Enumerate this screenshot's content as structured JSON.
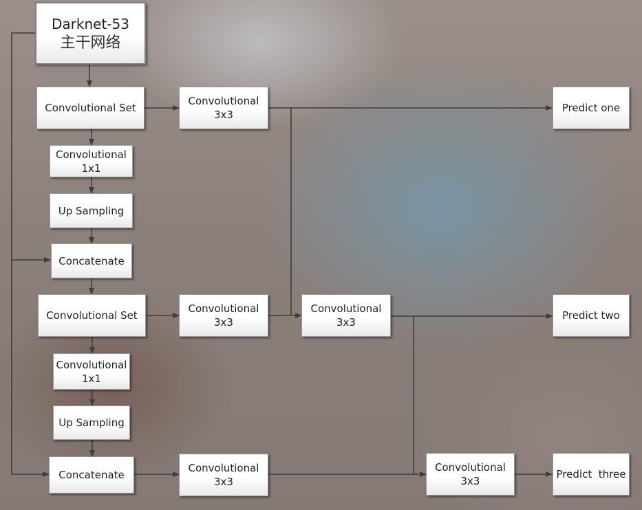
{
  "nodes": {
    "darknet": {
      "line1": "Darknet-53",
      "line2": "主干网络"
    },
    "conv_set_1": "Convolutional Set",
    "conv_3x3_a": {
      "line1": "Convolutional",
      "line2": "3x3"
    },
    "predict_one": "Predict one",
    "conv_1x1_a": {
      "line1": "Convolutional",
      "line2": "1x1"
    },
    "up_sampling_1": "Up Sampling",
    "concatenate_1": "Concatenate",
    "conv_set_2": "Convolutional Set",
    "conv_3x3_b": {
      "line1": "Convolutional",
      "line2": "3x3"
    },
    "conv_3x3_c": {
      "line1": "Convolutional",
      "line2": "3x3"
    },
    "predict_two": "Predict two",
    "conv_1x1_b": {
      "line1": "Convolutional",
      "line2": "1x1"
    },
    "up_sampling_2": "Up Sampling",
    "concatenate_2": "Concatenate",
    "conv_3x3_d": {
      "line1": "Convolutional",
      "line2": "3x3"
    },
    "conv_3x3_e": {
      "line1": "Convolutional",
      "line2": "3x3"
    },
    "predict_three": "Predict  three"
  },
  "colors": {
    "connector": "#3d3d3d",
    "box_border": "#9a9a9a"
  }
}
